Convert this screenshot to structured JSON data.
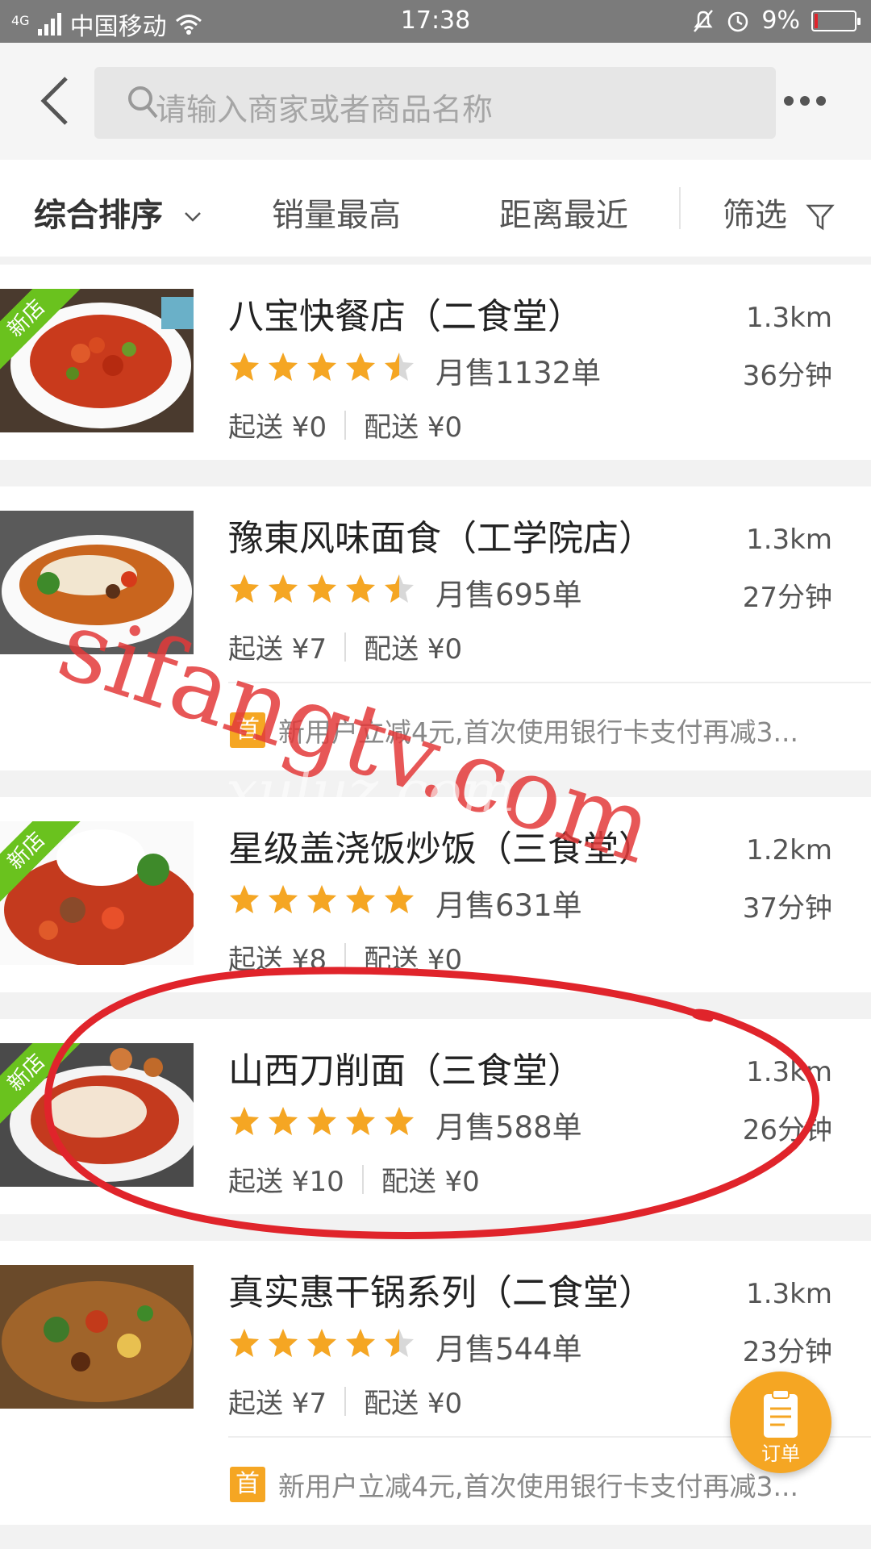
{
  "status": {
    "carrier": "中国移动",
    "network": "4G",
    "time": "17:38",
    "battery": "9%",
    "battery_level": 0.09
  },
  "search": {
    "placeholder": "请输入商家或者商品名称"
  },
  "sort": {
    "items": [
      "综合排序",
      "销量最高",
      "距离最近",
      "筛选"
    ]
  },
  "stores": [
    {
      "name": "八宝快餐店（二食堂）",
      "distance": "1.3km",
      "rating": 4.5,
      "sales": "月售1132单",
      "eta": "36分钟",
      "min_order": "起送 ¥0",
      "delivery": "配送 ¥0",
      "is_new": true,
      "new_label": "新店"
    },
    {
      "name": "豫東风味面食（工学院店）",
      "distance": "1.3km",
      "rating": 4.5,
      "sales": "月售695单",
      "eta": "27分钟",
      "min_order": "起送 ¥7",
      "delivery": "配送 ¥0",
      "is_new": false,
      "promo_badge": "首",
      "promo": "新用户立减4元,首次使用银行卡支付再减3..."
    },
    {
      "name": "星级盖浇饭炒饭（三食堂）",
      "distance": "1.2km",
      "rating": 5,
      "sales": "月售631单",
      "eta": "37分钟",
      "min_order": "起送 ¥8",
      "delivery": "配送 ¥0",
      "is_new": true,
      "new_label": "新店"
    },
    {
      "name": "山西刀削面（三食堂）",
      "distance": "1.3km",
      "rating": 5,
      "sales": "月售588单",
      "eta": "26分钟",
      "min_order": "起送 ¥10",
      "delivery": "配送 ¥0",
      "is_new": true,
      "new_label": "新店"
    },
    {
      "name": "真实惠干锅系列（二食堂）",
      "distance": "1.3km",
      "rating": 4.5,
      "sales": "月售544单",
      "eta": "23分钟",
      "min_order": "起送 ¥7",
      "delivery": "配送 ¥0",
      "is_new": false,
      "promo_badge": "首",
      "promo": "新用户立减4元,首次使用银行卡支付再减3..."
    }
  ],
  "fab": {
    "label": "订单"
  },
  "watermark": {
    "text": "sifangtv.com",
    "sub": "xuluz.com"
  },
  "colors": {
    "star": "#f5a623",
    "star_empty": "#d8d8d8",
    "new_tag": "#6ac21e",
    "promo_badge": "#f5a623",
    "annotation": "#e0242b"
  }
}
